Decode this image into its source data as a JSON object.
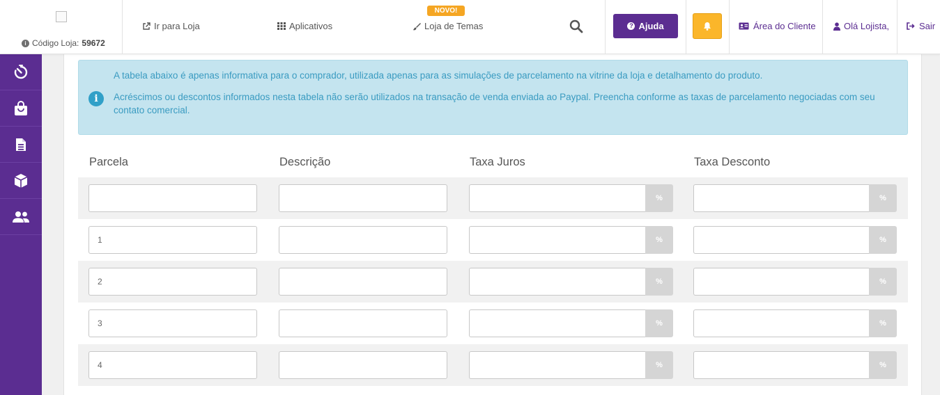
{
  "header": {
    "store_code_label": "Código Loja:",
    "store_code_value": "59672",
    "nav": {
      "go_to_store": "Ir para Loja",
      "apps": "Aplicativos",
      "themes": "Loja de Temas",
      "new_badge": "NOVO!"
    },
    "help_label": "Ajuda",
    "client_area": "Área do Cliente",
    "greeting": "Olá Lojista,",
    "logout": "Sair"
  },
  "colors": {
    "primary": "#5b2d91",
    "warning": "#fbb62a",
    "info_bg": "#c4e4ef",
    "info_text": "#3a9bc1"
  },
  "sidebar": {
    "items": [
      {
        "icon": "speedometer-icon"
      },
      {
        "icon": "shopping-bag-icon"
      },
      {
        "icon": "document-icon"
      },
      {
        "icon": "box-icon"
      },
      {
        "icon": "users-icon"
      }
    ]
  },
  "alert": {
    "line1": "A tabela abaixo é apenas informativa para o comprador, utilizada apenas para as simulações de parcelamento na vitrine da loja e detalhamento do produto.",
    "line2": "Acréscimos ou descontos informados nesta tabela não serão utilizados na transação de venda enviada ao Paypal. Preencha conforme as taxas de parcelamento negociadas com seu contato comercial."
  },
  "table": {
    "columns": [
      "Parcela",
      "Descrição",
      "Taxa Juros",
      "Taxa Desconto"
    ],
    "percent_symbol": "%",
    "rows": [
      {
        "parcela": "",
        "descricao": "",
        "juros": "",
        "desconto": ""
      },
      {
        "parcela": "1",
        "descricao": "",
        "juros": "",
        "desconto": ""
      },
      {
        "parcela": "2",
        "descricao": "",
        "juros": "",
        "desconto": ""
      },
      {
        "parcela": "3",
        "descricao": "",
        "juros": "",
        "desconto": ""
      },
      {
        "parcela": "4",
        "descricao": "",
        "juros": "",
        "desconto": ""
      }
    ]
  }
}
